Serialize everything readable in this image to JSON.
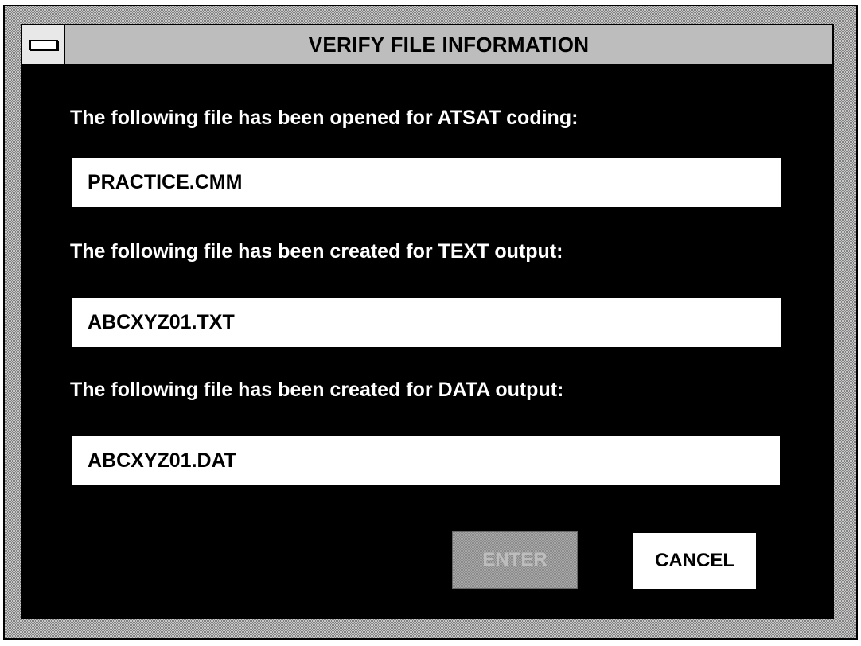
{
  "window": {
    "title": "VERIFY FILE INFORMATION",
    "system_menu_icon": "system-menu-icon"
  },
  "sections": [
    {
      "label": "The following file has been opened for ATSAT coding:",
      "value": "PRACTICE.CMM"
    },
    {
      "label": "The following file has been created for TEXT output:",
      "value": "ABCXYZ01.TXT"
    },
    {
      "label": "The following file has been created for DATA output:",
      "value": "ABCXYZ01.DAT"
    }
  ],
  "buttons": {
    "enter_label": "ENTER",
    "enter_state": "disabled",
    "cancel_label": "CANCEL"
  },
  "colors": {
    "client_background": "#000000",
    "field_background": "#ffffff",
    "label_text": "#ffffff",
    "title_bar": "#bdbdbd"
  }
}
